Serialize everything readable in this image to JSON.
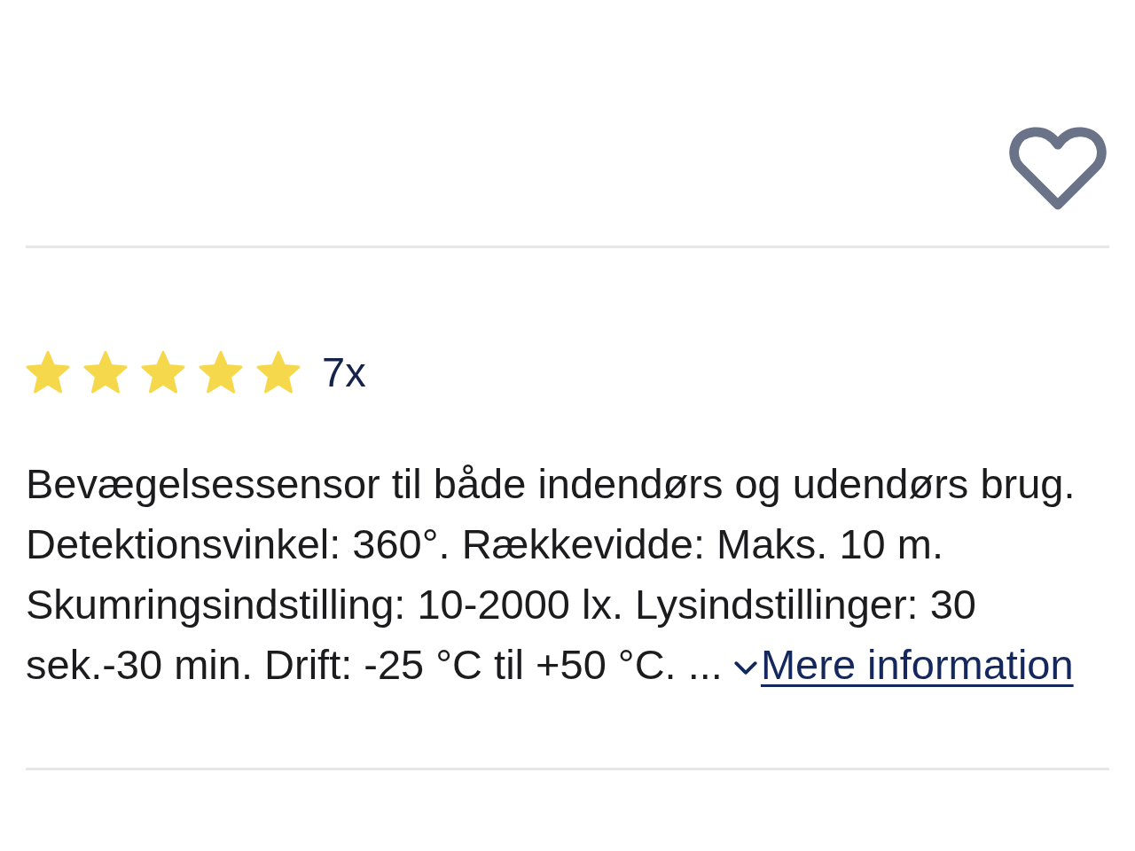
{
  "favorite": {
    "on": false
  },
  "rating": {
    "stars": 5,
    "count": "7x"
  },
  "description": {
    "text": "Bevægelsessensor til både indendørs og udendørs brug. Detektionsvinkel: 360°. Rækkevidde: Maks. 10 m. Skumringsindstilling: 10-2000 lx. Lysindstillinger: 30 sek.-30 min. Drift: -25 °C til +50 °C. ...",
    "more_link": "Mere information"
  }
}
